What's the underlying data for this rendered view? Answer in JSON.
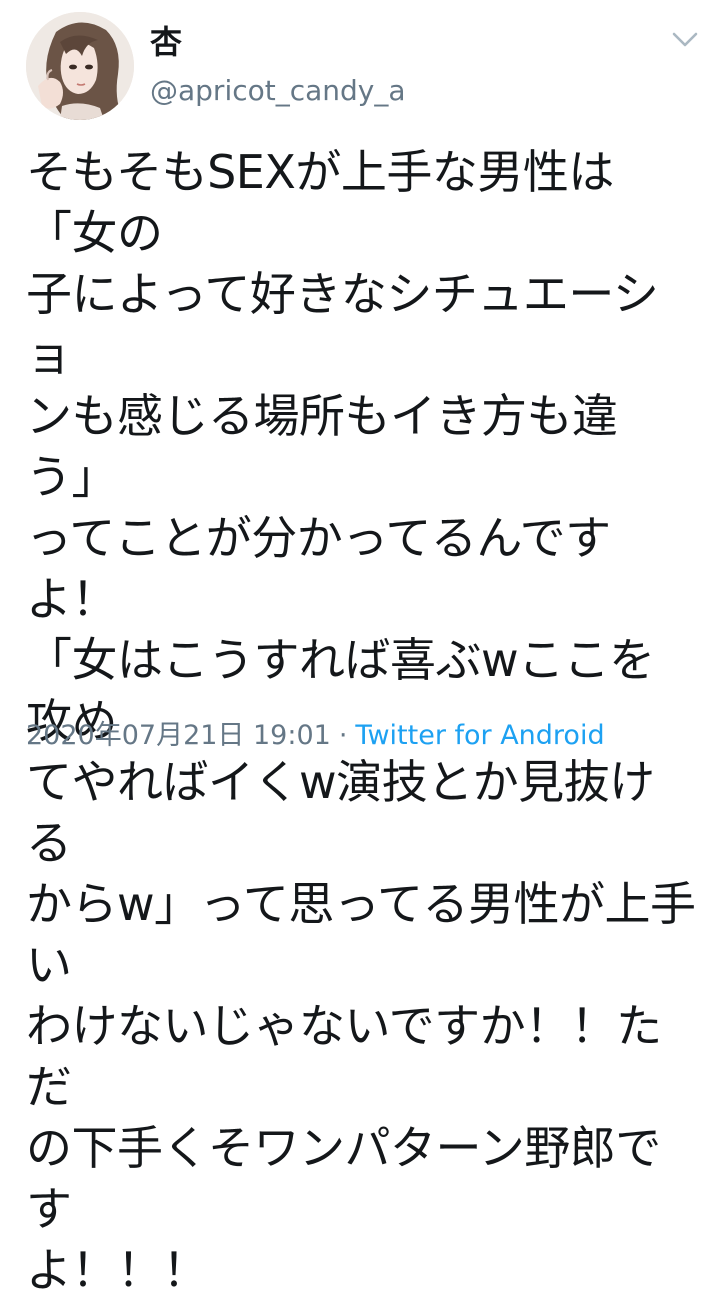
{
  "tweet": {
    "author": {
      "display_name": "杏",
      "handle": "@apricot_candy_a",
      "avatar_icon": "user-avatar-illustration"
    },
    "menu_icon": "chevron-down-icon",
    "text": "そもそもSEXが上手な男性は「女の\n子によって好きなシチュエーショ\nンも感じる場所もイき方も違う」\nってことが分かってるんですよ！\n「女はこうすれば喜ぶwここを攻め\nてやればイくw演技とか見抜ける\nからw」って思ってる男性が上手い\nわけないじゃないですか！！ただ\nの下手くそワンパターン野郎です\nよ！！！",
    "timestamp": "2020年07月21日 19:01",
    "separator": "·",
    "source": "Twitter for Android",
    "colors": {
      "text": "#14171a",
      "muted": "#657786",
      "link": "#1da1f2"
    }
  }
}
